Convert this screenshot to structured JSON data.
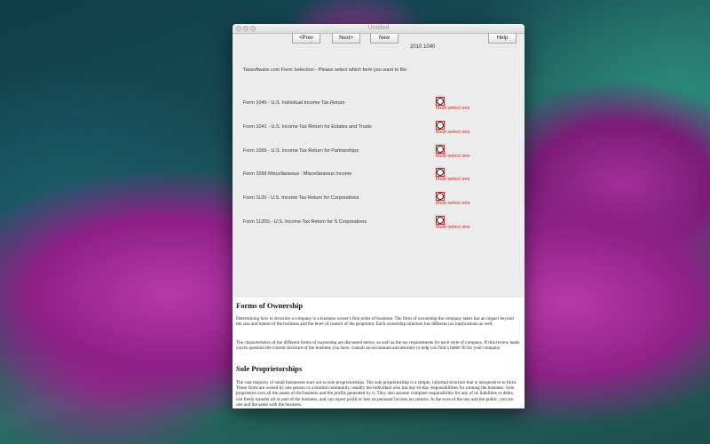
{
  "window": {
    "title": "Untitled"
  },
  "toolbar": {
    "prev_label": "<Prev",
    "next_label": "Next>",
    "new_label": "New",
    "help_label": "Help"
  },
  "form": {
    "year_label": "2010 1040",
    "prompt": "Taxsoftware.com Form Selection - Please select which form you want to file:",
    "options": [
      {
        "label": "Form 1040 - U.S. Individual Income Tax Return",
        "error": "Must select one"
      },
      {
        "label": "Form 1041 - U.S. Income Tax Return for Estates and Trusts",
        "error": "Must select one"
      },
      {
        "label": "Form 1065 - U.S. Income Tax Return for Partnerships",
        "error": "Must select one"
      },
      {
        "label": "Form 1099 Miscellaneous - Miscellaneous Income",
        "error": "Must select one"
      },
      {
        "label": "Form 1120 - U.S. Income Tax Return for Corporations",
        "error": "Must select one"
      },
      {
        "label": "Form 1120S - U.S. Income Tax Return for S Corporations",
        "error": "Must select one"
      }
    ]
  },
  "doc": {
    "heading1": "Forms of Ownership",
    "para1": "Determining how to structure a company is a business owner's first order of business. The form of ownership the company takes has an impact beyond the size and nature of the business and the level of control of the proprietor. Each ownership structure has different tax implications as well.",
    "para2": "The characteristics of the different forms of ownership are discussed below, as well as the tax requirements for each style of company. If this review leads you to question the current structure of the business you have, consult an accountant and attorney to help you find a better fit for your company.",
    "heading2": "Sole Proprietorships",
    "para3": "The vast majority of small businesses start out as sole proprietorships. The sole proprietorship is a simple, informal structure that is inexpensive to form. These firms are owned by one person or a marital community, usually the individual who has day-to-day responsibilities for running the business. Sole proprietors own all the assets of the business and the profits generated by it. They also assume complete responsibility for any of its liabilities or debts, can freely transfer all or part of the business, and can report profit or loss on personal income tax returns. In the eyes of the law and the public, you are one and the same with the business."
  }
}
